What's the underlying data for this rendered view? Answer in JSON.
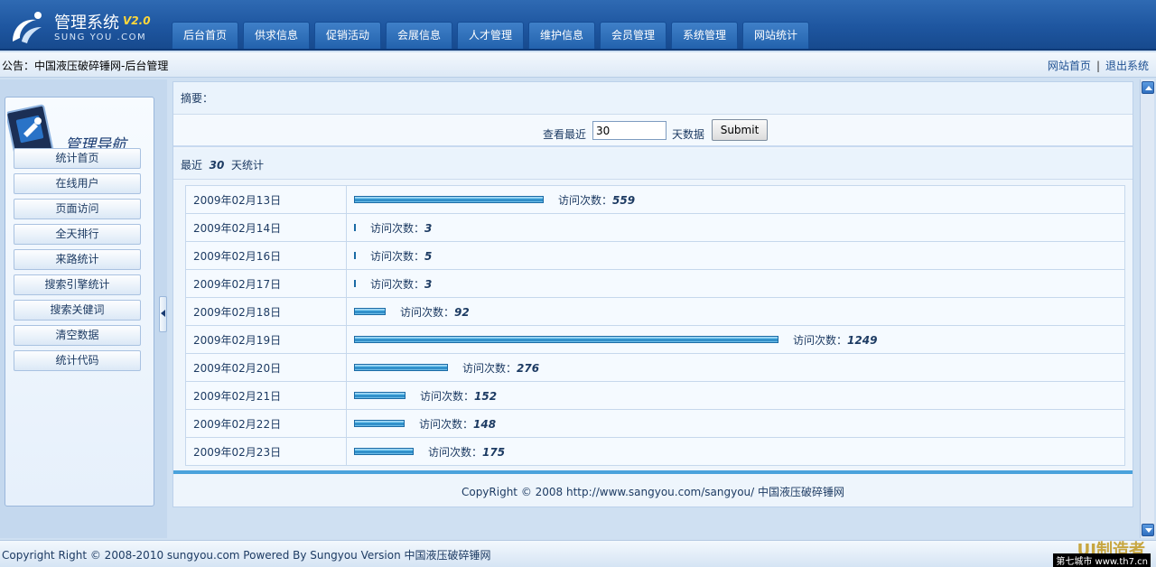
{
  "header": {
    "title": "管理系统",
    "version": "V2.0",
    "url": "SUNG YOU .COM",
    "nav": [
      "后台首页",
      "供求信息",
      "促销活动",
      "会展信息",
      "人才管理",
      "维护信息",
      "会员管理",
      "系统管理",
      "网站统计"
    ]
  },
  "notice": {
    "text": "公告：中国液压破碎锤网-后台管理",
    "home_link": "网站首页",
    "separator": "|",
    "logout_link": "退出系统"
  },
  "sidebar": {
    "title": "管理导航",
    "items": [
      "统计首页",
      "在线用户",
      "页面访问",
      "全天排行",
      "来路统计",
      "搜索引擎统计",
      "搜索关健词",
      "清空数据",
      "统计代码"
    ]
  },
  "main": {
    "summary_label": "摘要：",
    "query": {
      "prefix": "查看最近",
      "days_value": "30",
      "suffix": "天数据",
      "submit_label": "Submit"
    },
    "period": {
      "prefix": "最近",
      "days": "30",
      "suffix": "天统计"
    },
    "visit_label": "访问次数：",
    "rows": [
      {
        "date": "2009年02月13日",
        "count": "559",
        "value": 559
      },
      {
        "date": "2009年02月14日",
        "count": "3",
        "value": 3
      },
      {
        "date": "2009年02月16日",
        "count": "5",
        "value": 5
      },
      {
        "date": "2009年02月17日",
        "count": "3",
        "value": 3
      },
      {
        "date": "2009年02月18日",
        "count": "92",
        "value": 92
      },
      {
        "date": "2009年02月19日",
        "count": "1249",
        "value": 1249
      },
      {
        "date": "2009年02月20日",
        "count": "276",
        "value": 276
      },
      {
        "date": "2009年02月21日",
        "count": "152",
        "value": 152
      },
      {
        "date": "2009年02月22日",
        "count": "148",
        "value": 148
      },
      {
        "date": "2009年02月23日",
        "count": "175",
        "value": 175
      }
    ],
    "copyright": "CopyRight © 2008 http://www.sangyou.com/sangyou/ 中国液压破碎锤网"
  },
  "footer": {
    "text": "Copyright Right © 2008-2010 sungyou.com Powered By Sungyou Version 中国液压破碎锤网",
    "watermark_logo": "UI制造者",
    "watermark_site": "第七城市 www.th7.cn"
  },
  "colors": {
    "header": "#1e56a0",
    "bar": "#3fa6dc",
    "accent": "#4aa2dc"
  }
}
